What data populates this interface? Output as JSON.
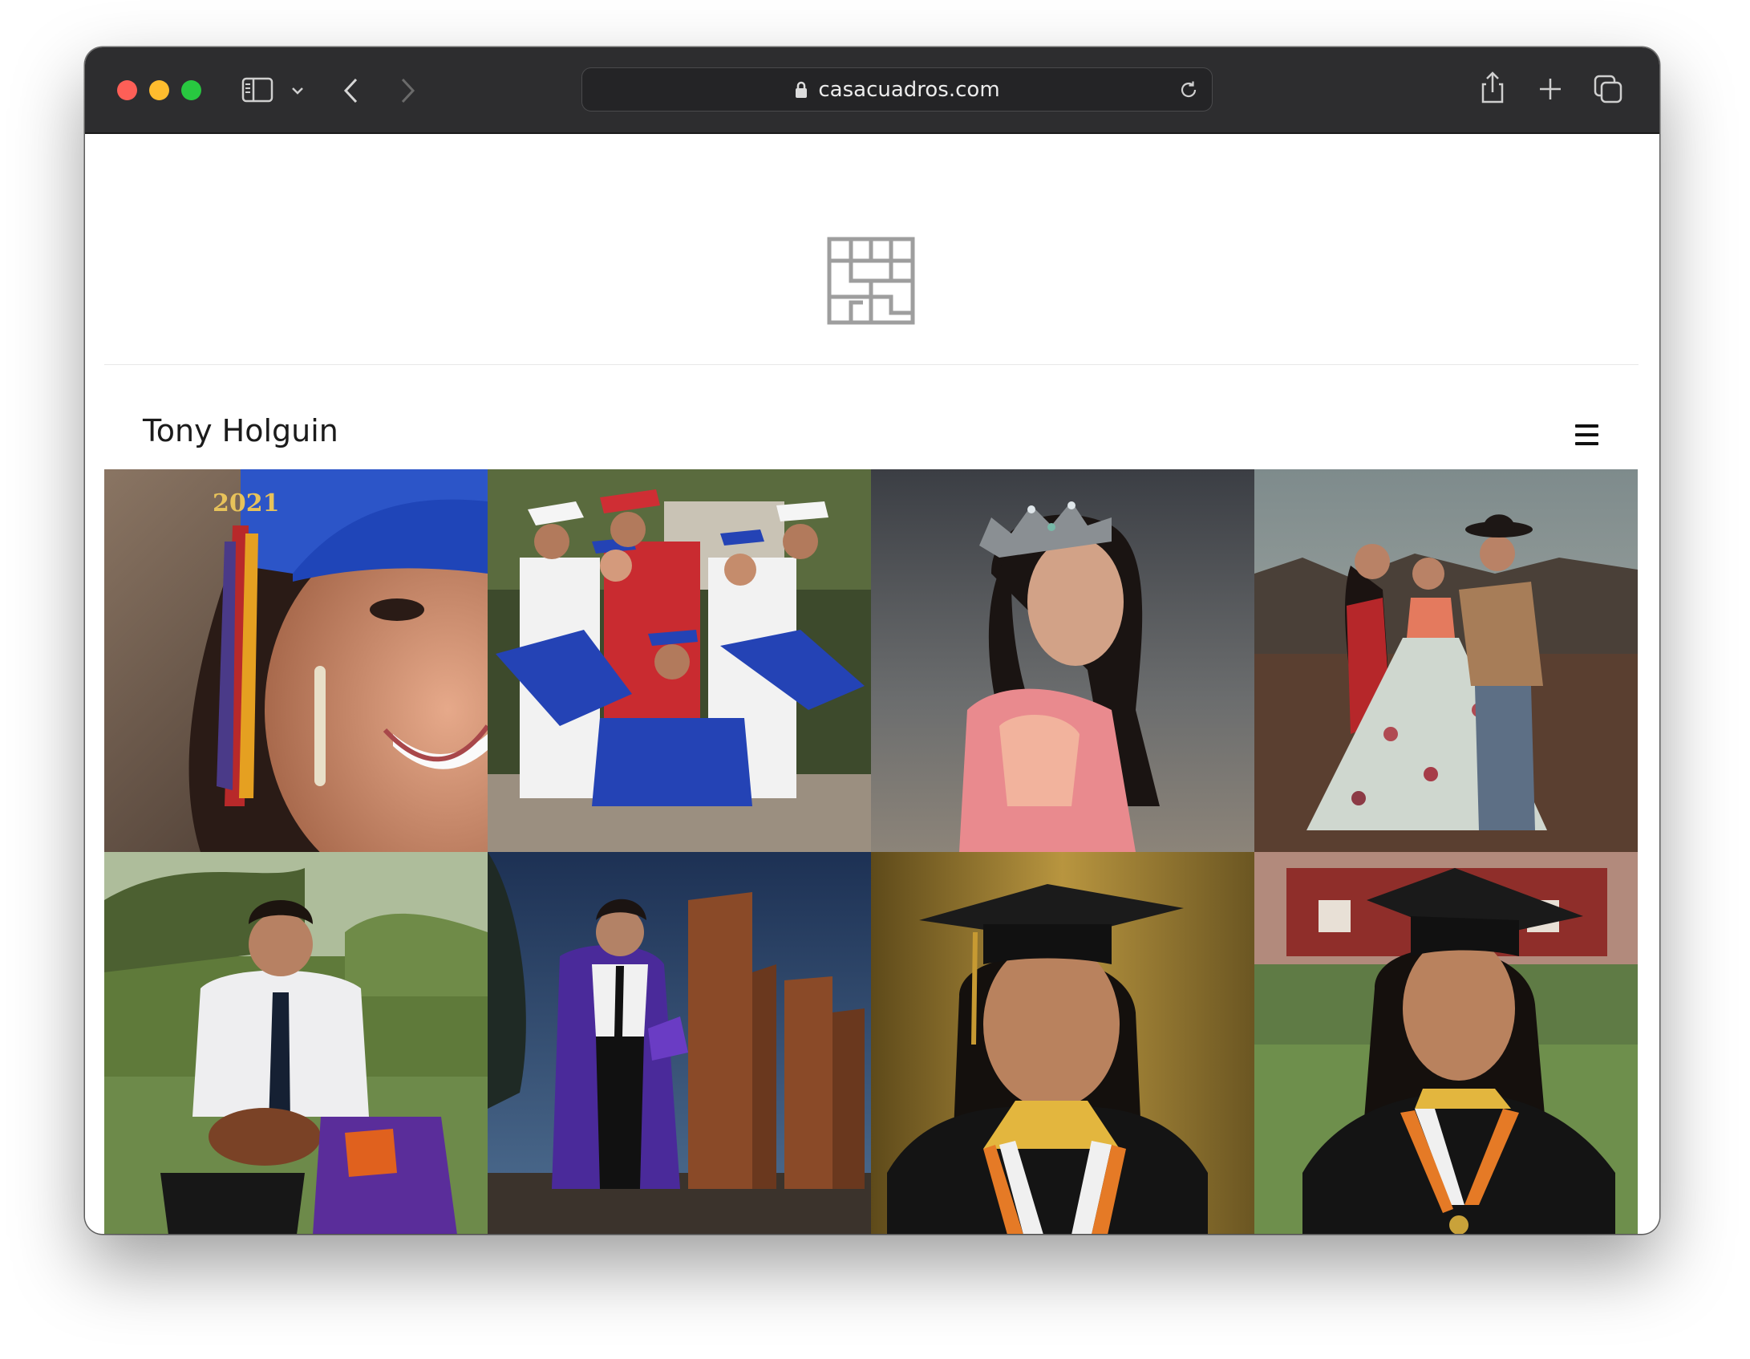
{
  "browser": {
    "url": "casacuadros.com",
    "icons": [
      "close",
      "minimize",
      "maximize",
      "sidebar-icon",
      "chevron-down-icon",
      "back-icon",
      "forward-icon",
      "lock-icon",
      "reload-icon",
      "share-icon",
      "new-tab-icon",
      "tabs-overview-icon"
    ],
    "colors": {
      "titlebar": "#2d2d2f",
      "close": "#fe5f57",
      "minimize": "#febc2e",
      "maximize": "#28c840"
    }
  },
  "site": {
    "logo_icon": "casa-cuadros-logo",
    "title": "Tony Holguin",
    "menu_icon": "hamburger-menu-icon"
  },
  "gallery": {
    "photos": [
      {
        "subject": "graduate-blue-cap-tassel-2021",
        "tassel_text": "2021"
      },
      {
        "subject": "group-graduates-red-white-blue-gowns"
      },
      {
        "subject": "girl-crown-pink-dress"
      },
      {
        "subject": "family-quinceanera-desert"
      },
      {
        "subject": "boy-football-letter-jacket"
      },
      {
        "subject": "boy-purple-gown-ehs-letters"
      },
      {
        "subject": "graduate-black-cap-orange-stole"
      },
      {
        "subject": "graduate-black-cap-medal"
      }
    ]
  }
}
